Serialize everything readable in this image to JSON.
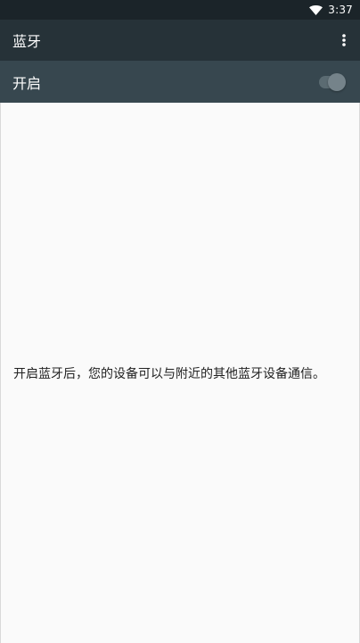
{
  "status_bar": {
    "time": "3:37",
    "icons": [
      "wifi-icon"
    ]
  },
  "app_bar": {
    "title": "蓝牙",
    "overflow_icon": "more-vert-icon"
  },
  "bluetooth_switch": {
    "label": "开启",
    "state": "off"
  },
  "content": {
    "message": "开启蓝牙后，您的设备可以与附近的其他蓝牙设备通信。"
  },
  "colors": {
    "status_bar_bg": "#1b2429",
    "app_bar_bg": "#263238",
    "switch_bar_bg": "#37474f",
    "content_bg": "#fafafa",
    "text_primary": "#212121"
  }
}
